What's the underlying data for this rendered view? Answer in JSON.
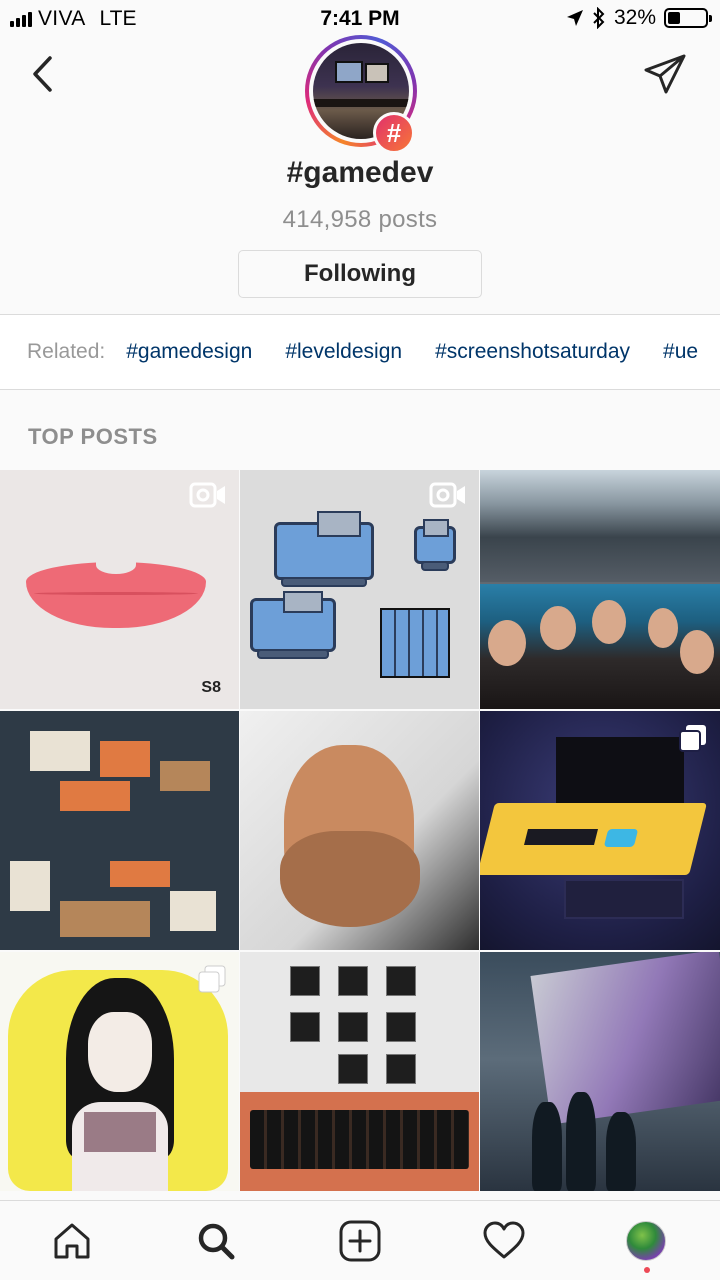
{
  "status_bar": {
    "carrier": "VIVA",
    "network": "LTE",
    "time": "7:41 PM",
    "battery_percent": "32%",
    "battery_level": 0.32
  },
  "header": {
    "back_icon": "chevron-left-icon",
    "send_icon": "paper-plane-icon",
    "hashtag_badge": "#",
    "title": "#gamedev",
    "post_count": "414,958 posts",
    "follow_button": "Following"
  },
  "related": {
    "label": "Related:",
    "tags": [
      "#gamedesign",
      "#leveldesign",
      "#screenshotsaturday",
      "#ue"
    ]
  },
  "section_title": "TOP POSTS",
  "posts": [
    {
      "type": "video",
      "watermark": "S8"
    },
    {
      "type": "video"
    },
    {
      "type": "photo"
    },
    {
      "type": "photo"
    },
    {
      "type": "photo"
    },
    {
      "type": "multiple"
    },
    {
      "type": "multiple"
    },
    {
      "type": "photo"
    },
    {
      "type": "photo"
    }
  ],
  "bottom_nav": {
    "items": [
      "home-icon",
      "search-icon",
      "add-post-icon",
      "activity-heart-icon",
      "profile-avatar"
    ],
    "active": "search-icon"
  },
  "colors": {
    "link": "#003569",
    "muted": "#8e8e8e",
    "notification_dot": "#ed4956"
  }
}
